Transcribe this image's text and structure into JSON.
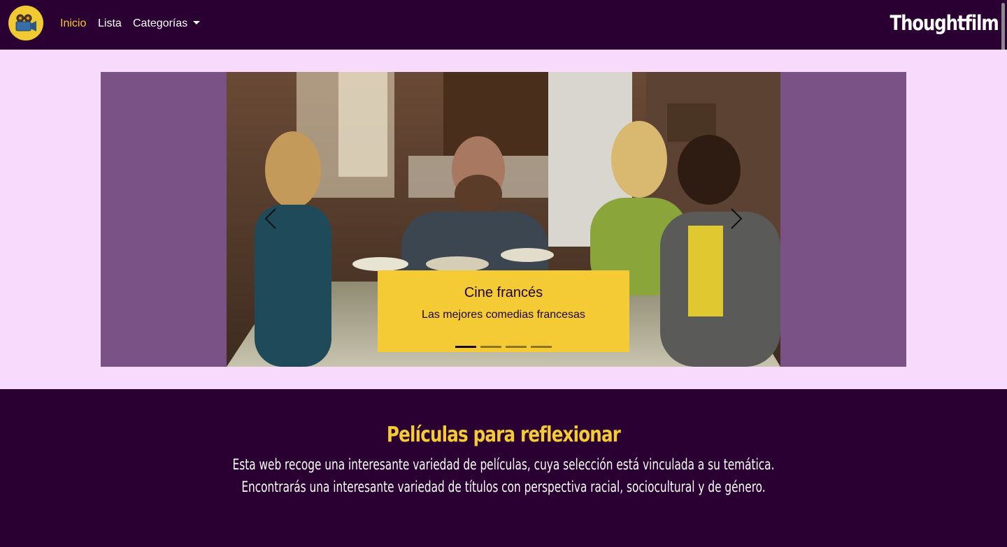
{
  "navbar": {
    "logo_icon": "film-camera-icon",
    "links": [
      {
        "label": "Inicio",
        "active": true
      },
      {
        "label": "Lista",
        "active": false
      },
      {
        "label": "Categorías",
        "active": false,
        "dropdown": true
      }
    ],
    "brand": "Thoughtfilm"
  },
  "carousel": {
    "slide_image": "family-dinner-scene-photo",
    "caption_title": "Cine francés",
    "caption_text": "Las mejores comedias francesas",
    "indicator_count": 4,
    "active_indicator": 1,
    "prev_icon": "chevron-left-icon",
    "next_icon": "chevron-right-icon"
  },
  "info": {
    "title": "Películas para reflexionar",
    "line1": "Esta web recoge una interesante variedad de películas, cuya selección está vinculada a su temática.",
    "line2": "Encontrarás una interesante variedad de títulos con perspectiva racial, sociocultural y de género."
  },
  "colors": {
    "navbar_bg": "#2a0033",
    "accent_yellow": "#f4ca35",
    "hero_bg": "#f8dafd",
    "carousel_bg": "#7a5285"
  }
}
